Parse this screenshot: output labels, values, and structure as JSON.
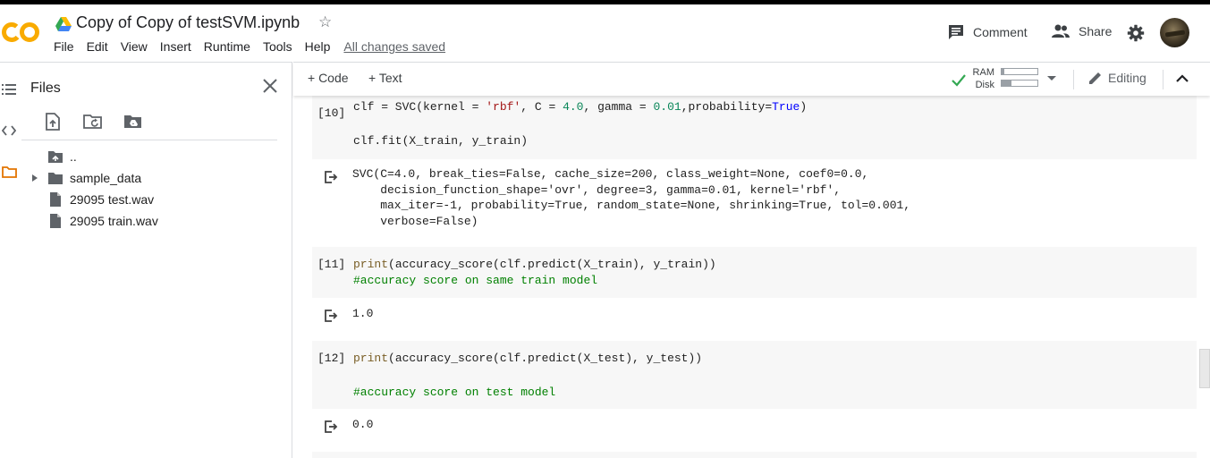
{
  "header": {
    "logo_text": "CO",
    "title": "Copy of Copy of testSVM.ipynb",
    "menu": [
      "File",
      "Edit",
      "View",
      "Insert",
      "Runtime",
      "Tools",
      "Help"
    ],
    "save_status": "All changes saved",
    "comment_label": "Comment",
    "share_label": "Share",
    "icons": [
      "drive-icon",
      "star-icon",
      "comment-icon",
      "share-icon",
      "gear-icon",
      "avatar"
    ]
  },
  "sidebar": {
    "title": "Files",
    "tree": [
      {
        "label": "..",
        "icon": "upload-folder-icon"
      },
      {
        "label": "sample_data",
        "icon": "folder-icon"
      },
      {
        "label": "29095 test.wav",
        "icon": "file-icon"
      },
      {
        "label": "29095 train.wav",
        "icon": "file-icon"
      }
    ]
  },
  "toolbar": {
    "add_code": "+ Code",
    "add_text": "+ Text",
    "ram_label": "RAM",
    "disk_label": "Disk",
    "ram_usage": 0.08,
    "disk_usage": 0.28,
    "editing_label": "Editing"
  },
  "cells": [
    {
      "prompt": "[10]",
      "output": "SVC(C=4.0, break_ties=False, cache_size=200, class_weight=None, coef0=0.0,\n    decision_function_shape='ovr', degree=3, gamma=0.01, kernel='rbf',\n    max_iter=-1, probability=True, random_state=None, shrinking=True, tol=0.001,\n    verbose=False)"
    },
    {
      "prompt": "[11]",
      "output": "1.0"
    },
    {
      "prompt": "[12]",
      "output": "0.0"
    }
  ],
  "colors": {
    "logo_orange": "#f9ab00",
    "string": "#a31515",
    "number": "#098658",
    "keyword": "#0000ff",
    "comment": "#008000",
    "check": "#34a853"
  }
}
